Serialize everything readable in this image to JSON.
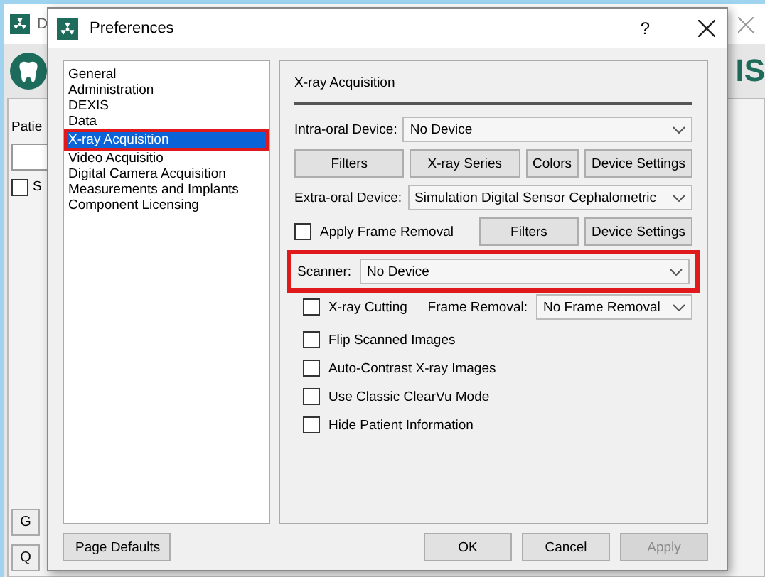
{
  "background_window": {
    "title": "D",
    "logo_text": "IS",
    "patient_label": "Patie",
    "checkbox": {
      "label": "S",
      "checked": false
    },
    "buttons": [
      "G",
      "Q"
    ]
  },
  "dialog": {
    "title": "Preferences",
    "help": "?"
  },
  "nav": [
    {
      "label": "General",
      "selected": false,
      "highlighted": false
    },
    {
      "label": "Administration",
      "selected": false,
      "highlighted": false
    },
    {
      "label": "DEXIS",
      "selected": false,
      "highlighted": false
    },
    {
      "label": "Data",
      "selected": false,
      "highlighted": false
    },
    {
      "label": "X-ray Acquisition",
      "selected": true,
      "highlighted": true
    },
    {
      "label": "Video Acquisitio",
      "selected": false,
      "highlighted": false
    },
    {
      "label": "Digital Camera Acquisition",
      "selected": false,
      "highlighted": false
    },
    {
      "label": "Measurements and Implants",
      "selected": false,
      "highlighted": false
    },
    {
      "label": "Component Licensing",
      "selected": false,
      "highlighted": false
    }
  ],
  "page_defaults": "Page Defaults",
  "section_title": "X-ray Acquisition",
  "intraoral": {
    "label": "Intra-oral Device:",
    "value": "No Device"
  },
  "intraoral_buttons": [
    "Filters",
    "X-ray Series",
    "Colors",
    "Device Settings"
  ],
  "extraoral": {
    "label": "Extra-oral Device:",
    "value": "Simulation Digital Sensor Cephalometric"
  },
  "apply_frame_removal": {
    "label": "Apply Frame Removal",
    "checked": false
  },
  "extraoral_buttons": [
    "Filters",
    "Device Settings"
  ],
  "scanner": {
    "label": "Scanner:",
    "value": "No Device",
    "highlighted": true
  },
  "options": [
    {
      "label": "X-ray Cutting",
      "checked": false
    },
    {
      "label": "Flip Scanned Images",
      "checked": false
    },
    {
      "label": "Auto-Contrast X-ray Images",
      "checked": false
    },
    {
      "label": "Use Classic ClearVu Mode",
      "checked": false
    },
    {
      "label": "Hide Patient Information",
      "checked": false
    }
  ],
  "frame_removal": {
    "label": "Frame Removal:",
    "value": "No Frame Removal"
  },
  "footer_buttons": [
    {
      "label": "OK",
      "disabled": false
    },
    {
      "label": "Cancel",
      "disabled": false
    },
    {
      "label": "Apply",
      "disabled": true
    }
  ]
}
